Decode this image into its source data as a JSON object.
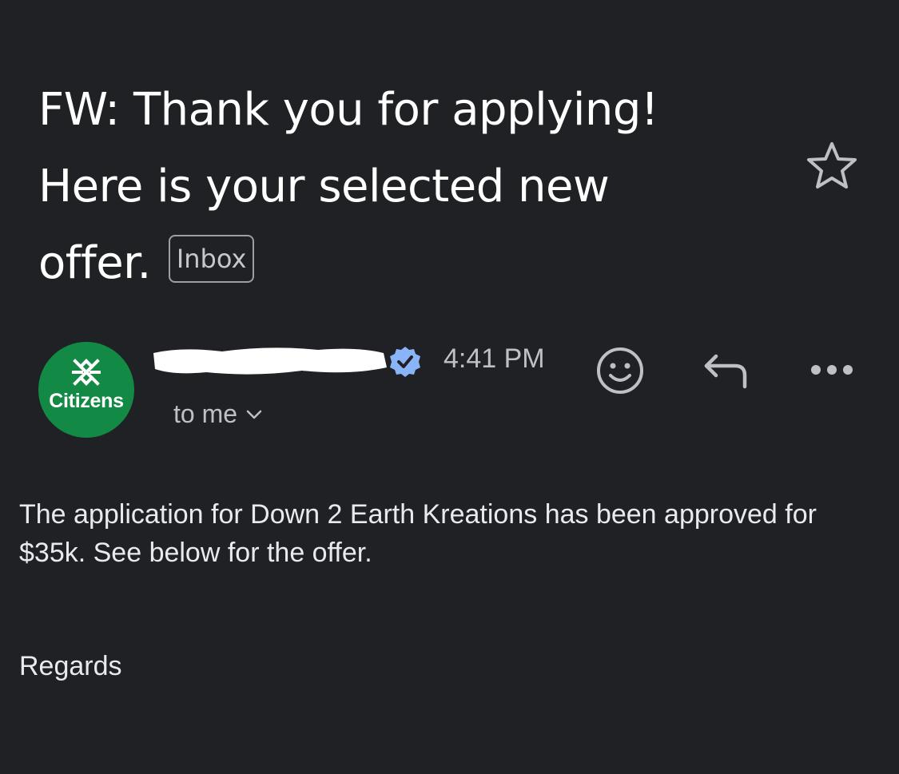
{
  "email": {
    "subject_lines": [
      "FW: Thank you for applying!",
      "Here is your selected new",
      "offer."
    ],
    "label": "Inbox",
    "sender": {
      "avatar_text": "Citizens",
      "avatar_color": "#128a45",
      "verified_color": "#8ab4f8"
    },
    "time": "4:41 PM",
    "recipient": "to me",
    "body": "The application for Down 2 Earth Kreations has been approved for $35k. See below for the offer.",
    "signoff": "Regards"
  },
  "icons": {
    "star": "star-outline-icon",
    "verified": "verified-badge-icon",
    "react": "smiley-face-icon",
    "reply": "reply-arrow-icon",
    "more": "more-horizontal-icon",
    "chevron": "chevron-down-icon"
  },
  "theme": {
    "background": "#202124",
    "text_primary": "#ffffff",
    "text_secondary": "#bdc1c6"
  }
}
